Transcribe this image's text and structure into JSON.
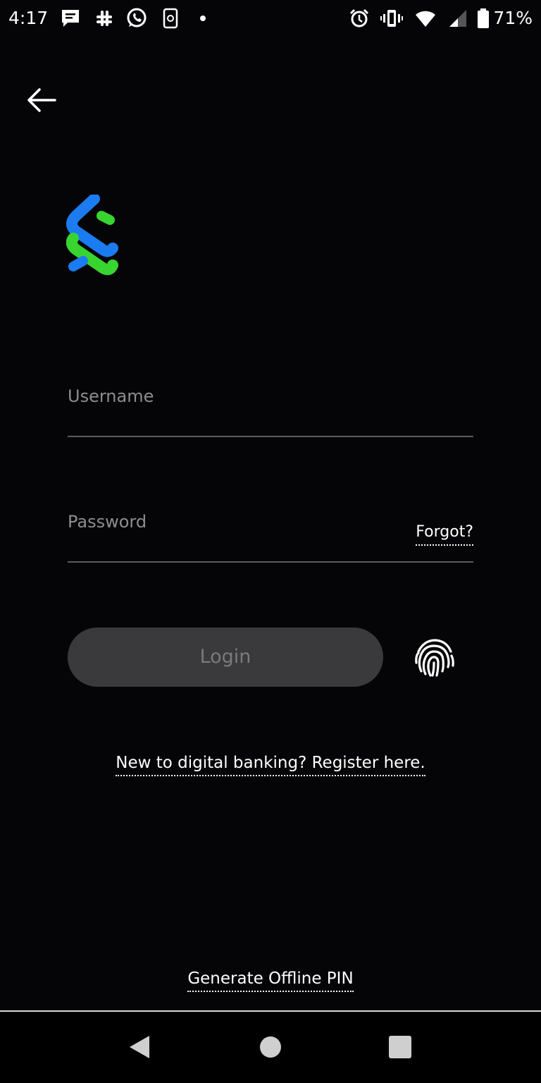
{
  "status_bar": {
    "time": "4:17",
    "battery_percent": "71%",
    "left_icons": [
      "message-icon",
      "slack-icon",
      "whatsapp-icon",
      "app-icon",
      "dot-icon"
    ],
    "right_icons": [
      "alarm-icon",
      "vibrate-icon",
      "wifi-icon",
      "signal-icon",
      "battery-icon"
    ],
    "battery_level": 0.71
  },
  "header": {
    "back_icon": "back-arrow-icon"
  },
  "brand": {
    "logo": "standard-chartered-logo",
    "colors": {
      "blue": "#1b7cf2",
      "green": "#38d430"
    }
  },
  "form": {
    "username_placeholder": "Username",
    "password_placeholder": "Password",
    "forgot_label": "Forgot?",
    "login_label": "Login",
    "fingerprint_icon": "fingerprint-icon"
  },
  "links": {
    "register": "New to digital banking? Register here.",
    "offline_pin": "Generate Offline PIN"
  },
  "nav": {
    "back_icon": "nav-back-icon",
    "home_icon": "nav-home-icon",
    "recents_icon": "nav-recents-icon"
  },
  "theme": {
    "background": "#050508",
    "button_bg": "#3a3a3c",
    "button_text": "#7a7a7d",
    "placeholder": "#8d8d90",
    "underline": "#5c5c5f"
  }
}
